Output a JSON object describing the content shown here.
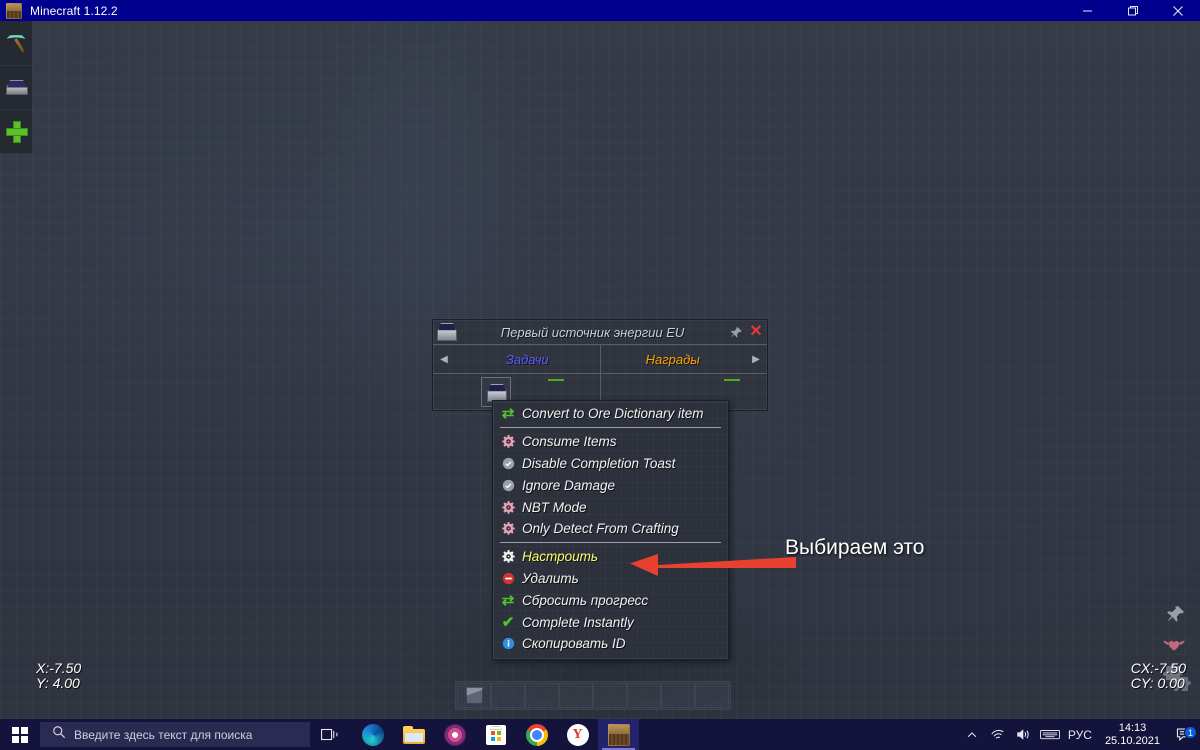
{
  "window": {
    "title": "Minecraft 1.12.2",
    "icon": "minecraft-block-icon",
    "controls": {
      "minimize": "minimize-icon",
      "restore": "restore-icon",
      "close": "close-icon"
    }
  },
  "left_toolbar": {
    "items": [
      {
        "icon": "pickaxe-icon",
        "name": "pickaxe-tool"
      },
      {
        "icon": "enchant-block-icon",
        "name": "block-tool"
      },
      {
        "icon": "plus-icon",
        "name": "add-tool"
      }
    ]
  },
  "edge_icons": [
    {
      "icon": "pushpin-icon",
      "name": "pin-overlay-icon"
    },
    {
      "icon": "winged-heart-icon",
      "name": "heart-overlay-icon"
    }
  ],
  "overlay": {
    "left_coords": {
      "x": "X:-7.50",
      "y": "Y: 4.00"
    },
    "right_coords": {
      "cx": "CX:-7.50",
      "cy": "CY: 0.00"
    },
    "puzzle_icon": "puzzle-piece-icon"
  },
  "hotbar": {
    "slot_count": 9,
    "filled_slot_index": 0
  },
  "quest_dialog": {
    "icon": "machine-block-icon",
    "title": "Первый источник энергии EU",
    "pin_icon": "pushpin-icon",
    "close_label": "✕",
    "nav": {
      "left": "◀",
      "right": "▶"
    },
    "tabs": [
      {
        "label": "Задачи",
        "color": "#5b5bff"
      },
      {
        "label": "Награды",
        "color": "#ffa500"
      }
    ]
  },
  "context_menu": {
    "items": [
      {
        "label": "Convert to Ore Dictionary item",
        "icon": "recycle-arrows-icon",
        "icon_class": "ic-recycle",
        "hovered": false
      },
      {
        "separator": true
      },
      {
        "label": "Consume Items",
        "icon": "gear-icon",
        "icon_class": "ic-gear-pink",
        "hovered": false
      },
      {
        "label": "Disable Completion Toast",
        "icon": "check-circle-icon",
        "icon_class": "ic-check-circle",
        "hovered": false
      },
      {
        "label": "Ignore Damage",
        "icon": "check-circle-icon",
        "icon_class": "ic-check-circle",
        "hovered": false
      },
      {
        "label": "NBT Mode",
        "icon": "gear-icon",
        "icon_class": "ic-gear-pink",
        "hovered": false
      },
      {
        "label": "Only Detect From Crafting",
        "icon": "gear-icon",
        "icon_class": "ic-gear-pink",
        "hovered": false
      },
      {
        "separator": true
      },
      {
        "label": "Настроить",
        "icon": "gear-icon",
        "icon_class": "ic-gear-white",
        "hovered": true
      },
      {
        "label": "Удалить",
        "icon": "deny-circle-icon",
        "icon_class": "ic-deny",
        "hovered": false
      },
      {
        "label": "Сбросить прогресс",
        "icon": "recycle-arrows-icon",
        "icon_class": "ic-recycle",
        "hovered": false
      },
      {
        "label": "Complete Instantly",
        "icon": "checkmark-icon",
        "icon_class": "ic-check",
        "hovered": false
      },
      {
        "label": "Скопировать ID",
        "icon": "info-circle-icon",
        "icon_class": "ic-info",
        "hovered": false
      }
    ]
  },
  "annotation": {
    "text": "Выбираем это",
    "arrow_color": "#e8412f",
    "arrow_icon": "left-arrow-annotation-icon"
  },
  "taskbar": {
    "start_icon": "windows-logo-icon",
    "search": {
      "placeholder": "Введите здесь текст для поиска",
      "icon": "search-icon"
    },
    "taskview_icon": "task-view-icon",
    "apps": [
      {
        "name": "edge",
        "icon": "edge-icon",
        "active": false
      },
      {
        "name": "file-explorer",
        "icon": "folder-icon",
        "active": false
      },
      {
        "name": "media-player",
        "icon": "media-player-icon",
        "active": false
      },
      {
        "name": "microsoft-store",
        "icon": "store-icon",
        "active": false
      },
      {
        "name": "chrome",
        "icon": "chrome-icon",
        "active": false
      },
      {
        "name": "yandex-browser",
        "icon": "yandex-icon",
        "active": false
      },
      {
        "name": "minecraft",
        "icon": "minecraft-block-icon",
        "active": true
      }
    ],
    "tray": {
      "chevron": "chevron-up-icon",
      "network": "wifi-icon",
      "volume": "volume-icon",
      "keyboard": "keyboard-icon",
      "language": "РУС",
      "time": "14:13",
      "date": "25.10.2021",
      "notification_icon": "notification-icon",
      "notification_count": "1"
    }
  },
  "colors": {
    "titlebar": "#00008f",
    "taskbar": "#13133b",
    "game_bg": "#333845",
    "accent_yellow": "#ffff6e",
    "accent_red": "#e8412f"
  }
}
